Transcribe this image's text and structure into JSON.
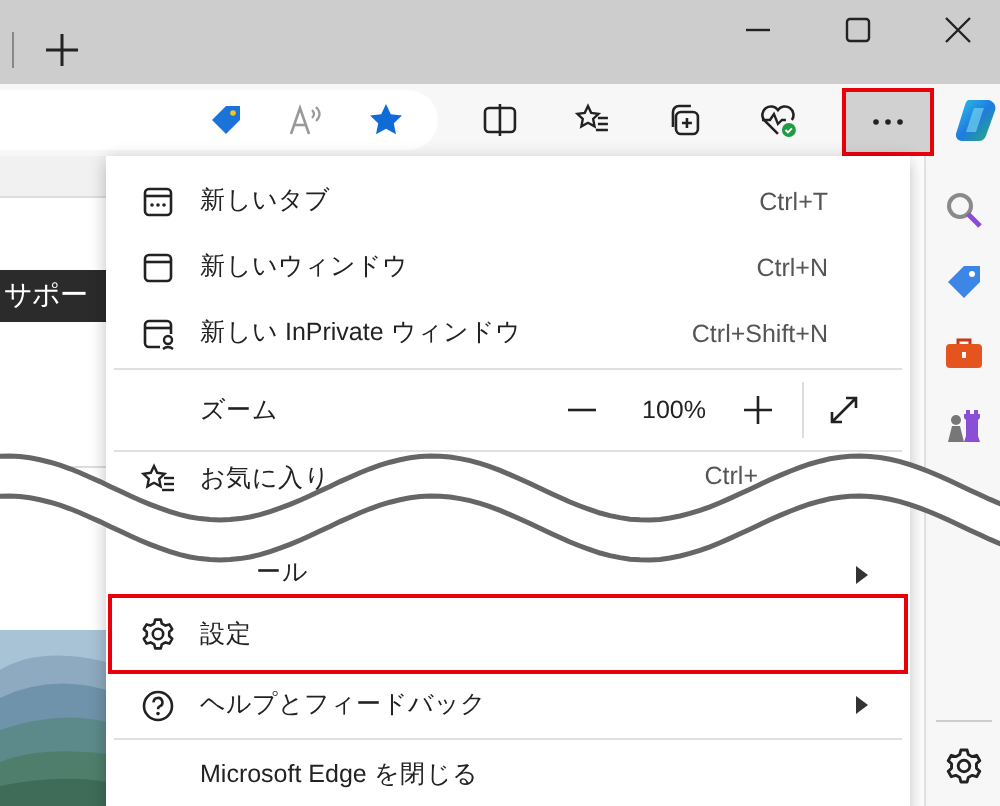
{
  "toolbar": {
    "more_button": {
      "highlighted": true
    }
  },
  "page": {
    "banner_label": "サポー"
  },
  "menu": {
    "items": [
      {
        "kind": "item",
        "label": "新しいタブ",
        "shortcut": "Ctrl+T",
        "highlighted": false
      },
      {
        "kind": "item",
        "label": "新しいウィンドウ",
        "shortcut": "Ctrl+N",
        "highlighted": false
      },
      {
        "kind": "item",
        "label": "新しい InPrivate ウィンドウ",
        "shortcut": "Ctrl+Shift+N",
        "highlighted": false
      },
      {
        "kind": "separator"
      },
      {
        "kind": "zoom",
        "label": "ズーム",
        "value": "100%",
        "highlighted": false
      },
      {
        "kind": "separator"
      },
      {
        "kind": "item",
        "label": "お気に入り",
        "shortcut": "Ctrl+",
        "highlighted": false
      },
      {
        "kind": "submenu",
        "label": "ール",
        "highlighted": false
      },
      {
        "kind": "item",
        "label": "設定",
        "highlighted": true
      },
      {
        "kind": "submenu",
        "label": "ヘルプとフィードバック",
        "highlighted": false
      },
      {
        "kind": "separator"
      },
      {
        "kind": "item",
        "label": "Microsoft Edge を閉じる",
        "highlighted": false
      }
    ]
  }
}
